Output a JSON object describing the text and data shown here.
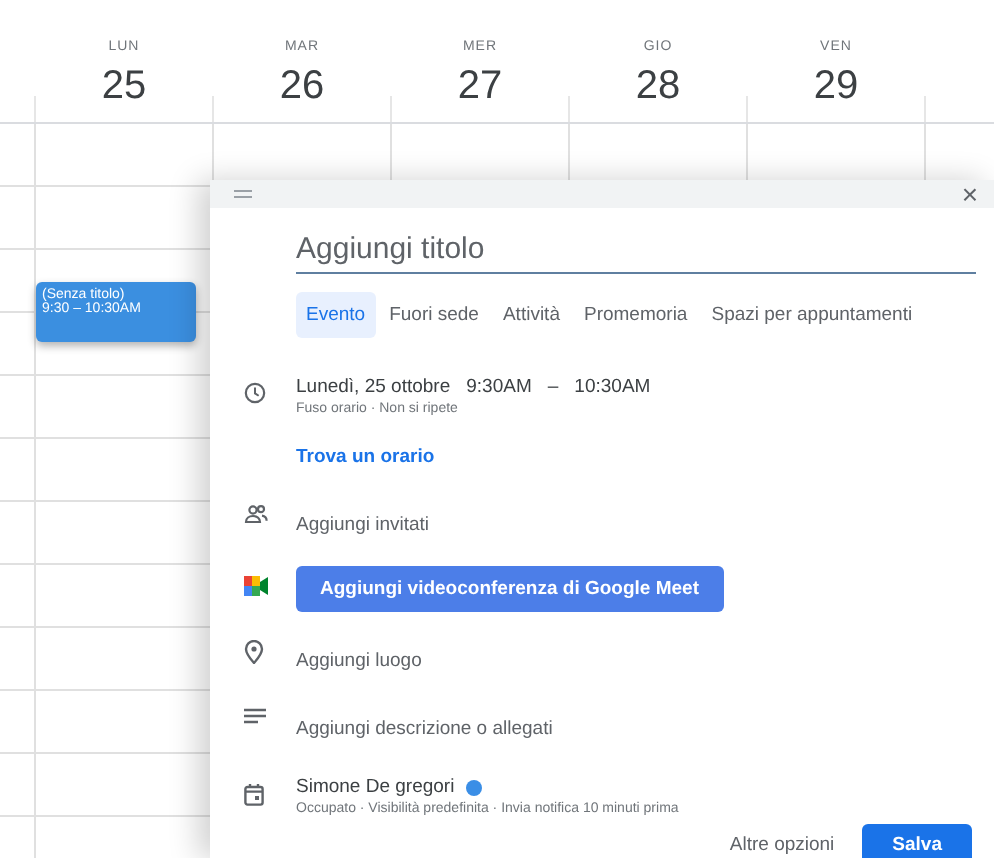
{
  "days": [
    {
      "weekday": "LUN",
      "date": "25"
    },
    {
      "weekday": "MAR",
      "date": "26"
    },
    {
      "weekday": "MER",
      "date": "27"
    },
    {
      "weekday": "GIO",
      "date": "28"
    },
    {
      "weekday": "VEN",
      "date": "29"
    }
  ],
  "event_chip": {
    "title": "(Senza titolo)",
    "time": "9:30 – 10:30AM"
  },
  "dialog": {
    "close": "×",
    "title_placeholder": "Aggiungi titolo",
    "tabs": [
      {
        "label": "Evento",
        "selected": true
      },
      {
        "label": "Fuori sede",
        "selected": false
      },
      {
        "label": "Attività",
        "selected": false
      },
      {
        "label": "Promemoria",
        "selected": false
      },
      {
        "label": "Spazi per appuntamenti",
        "selected": false
      }
    ],
    "rows": [
      {
        "kind": "datetime",
        "date": "Lunedì, 25 ottobre",
        "start": "9:30AM",
        "dash": "–",
        "end": "10:30AM",
        "detail": "Fuso orario · Non si ripete"
      },
      {
        "kind": "link",
        "label": "Trova un orario"
      },
      {
        "kind": "text",
        "label": "Aggiungi invitati"
      },
      {
        "kind": "button",
        "label": "Aggiungi videoconferenza di Google Meet"
      },
      {
        "kind": "text",
        "label": "Aggiungi luogo"
      },
      {
        "kind": "text",
        "label": "Aggiungi descrizione o allegati"
      },
      {
        "kind": "calendar",
        "label": "Simone De gregori",
        "color": "#3a8ee6",
        "detail": "Occupato · Visibilità predefinita · Invia notifica 10 minuti prima"
      }
    ],
    "more_options": "Altre opzioni",
    "save": "Salva"
  }
}
